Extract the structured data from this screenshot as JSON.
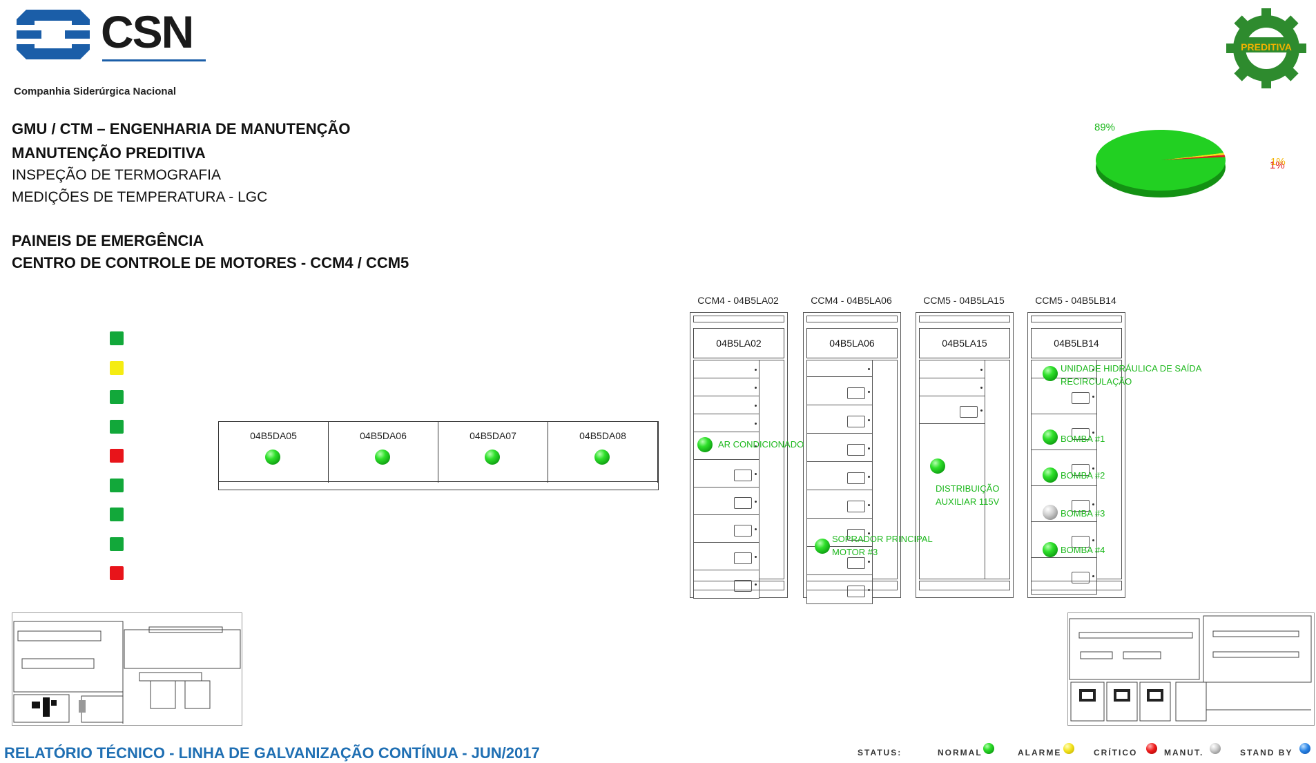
{
  "header": {
    "logo_text": "CSN",
    "company_name": "Companhia Siderúrgica Nacional",
    "badge_text": "PREDITIVA"
  },
  "titles": {
    "line1": "GMU / CTM – ENGENHARIA DE MANUTENÇÃO",
    "line2": "MANUTENÇÃO PREDITIVA",
    "line3": "INSPEÇÃO DE TERMOGRAFIA",
    "line4": "MEDIÇÕES DE TEMPERATURA - LGC",
    "line5": "PAINEIS DE EMERGÊNCIA",
    "line6": "CENTRO DE CONTROLE DE MOTORES - CCM4 / CCM5"
  },
  "pie": {
    "label_main": "89%",
    "label_small_a": "1%",
    "label_small_b": "1%"
  },
  "chart_data": {
    "type": "pie",
    "slices": [
      {
        "value": 89,
        "color": "#22d022"
      },
      {
        "value": 1,
        "color": "#f3e21a"
      },
      {
        "value": 1,
        "color": "#e02020"
      }
    ]
  },
  "status_squares": [
    "#12a83a",
    "#f5ec12",
    "#12a83a",
    "#12a83a",
    "#e8141a",
    "#12a83a",
    "#12a83a",
    "#12a83a",
    "#e8141a"
  ],
  "da_panels": [
    {
      "label": "04B5DA05",
      "status": "green"
    },
    {
      "label": "04B5DA06",
      "status": "green"
    },
    {
      "label": "04B5DA07",
      "status": "green"
    },
    {
      "label": "04B5DA08",
      "status": "green"
    }
  ],
  "cabinets": [
    {
      "title": "CCM4 - 04B5LA02",
      "head": "04B5LA02"
    },
    {
      "title": "CCM4 - 04B5LA06",
      "head": "04B5LA06"
    },
    {
      "title": "CCM5 - 04B5LA15",
      "head": "04B5LA15"
    },
    {
      "title": "CCM5 - 04B5LB14",
      "head": "04B5LB14"
    }
  ],
  "cabinet_points": [
    {
      "status": "green",
      "label": "AR CONDICIONADO"
    },
    {
      "status": "green",
      "label_a": "SOPRADOR PRINCIPAL",
      "label_b": "MOTOR #3"
    },
    {
      "status": "green",
      "label_a": "DISTRIBUIÇÃO",
      "label_b": "AUXILIAR 115V"
    },
    {
      "status": "green",
      "label_a": "UNIDADE HIDRÁULICA DE SAÍDA",
      "label_b": "RECIRCULAÇÃO"
    },
    {
      "status": "green",
      "label": "BOMBA #1"
    },
    {
      "status": "green",
      "label": "BOMBA #2"
    },
    {
      "status": "gray",
      "label": "BOMBA #3"
    },
    {
      "status": "green",
      "label": "BOMBA #4"
    }
  ],
  "footer": {
    "report_title": "RELATÓRIO TÉCNICO - LINHA DE GALVANIZAÇÃO CONTÍNUA - JUN/2017",
    "status_label": "STATUS:",
    "legend": [
      {
        "label": "NORMAL",
        "color": "green"
      },
      {
        "label": "ALARME",
        "color": "yellow"
      },
      {
        "label": "CRÍTICO",
        "color": "red"
      },
      {
        "label": "MANUT.",
        "color": "gray"
      },
      {
        "label": "STAND BY",
        "color": "blue"
      }
    ]
  }
}
